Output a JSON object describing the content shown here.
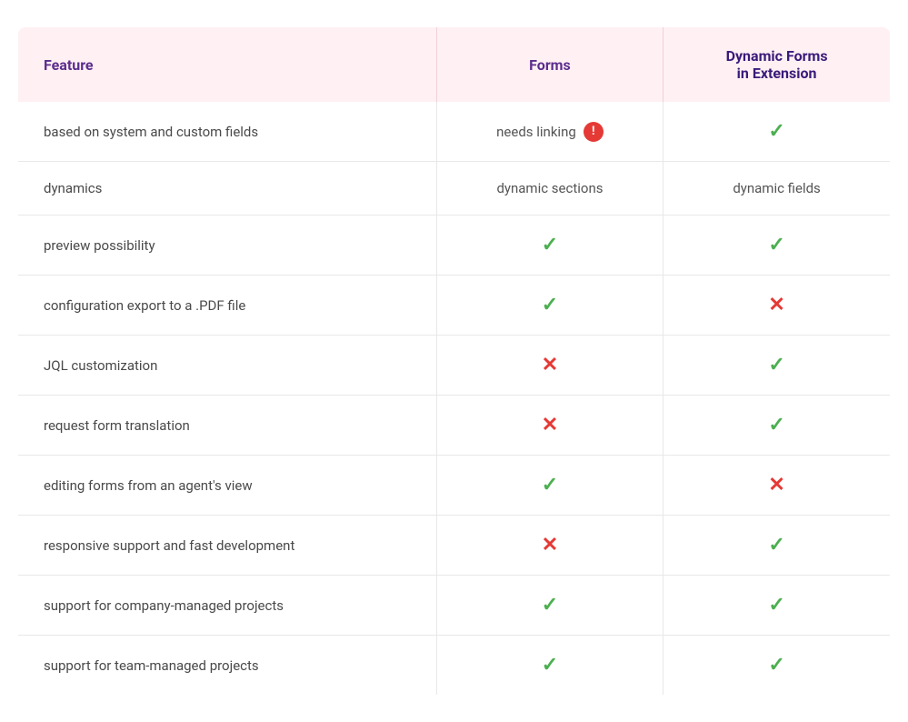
{
  "header": {
    "col1_label": "Feature",
    "col2_label": "Forms",
    "col3_line1": "Dynamic Forms",
    "col3_line2": "in Extension"
  },
  "rows": [
    {
      "feature": "based on system and custom fields",
      "forms_type": "text",
      "forms_value": "needs linking",
      "forms_warning": "!",
      "dynamic_type": "check"
    },
    {
      "feature": "dynamics",
      "forms_type": "text",
      "forms_value": "dynamic sections",
      "dynamic_type": "text",
      "dynamic_value": "dynamic fields"
    },
    {
      "feature": "preview possibility",
      "forms_type": "check",
      "dynamic_type": "check"
    },
    {
      "feature": "configuration export to a .PDF file",
      "forms_type": "check",
      "dynamic_type": "cross"
    },
    {
      "feature": "JQL customization",
      "forms_type": "cross",
      "dynamic_type": "check"
    },
    {
      "feature": "request form translation",
      "forms_type": "cross",
      "dynamic_type": "check"
    },
    {
      "feature": "editing forms from an agent's view",
      "forms_type": "check",
      "dynamic_type": "cross"
    },
    {
      "feature": "responsive support and fast development",
      "forms_type": "cross",
      "dynamic_type": "check"
    },
    {
      "feature": "support for company-managed projects",
      "forms_type": "check",
      "dynamic_type": "check"
    },
    {
      "feature": "support for team-managed projects",
      "forms_type": "check",
      "dynamic_type": "check"
    }
  ],
  "icons": {
    "check": "✓",
    "cross": "✕",
    "warning": "!"
  }
}
